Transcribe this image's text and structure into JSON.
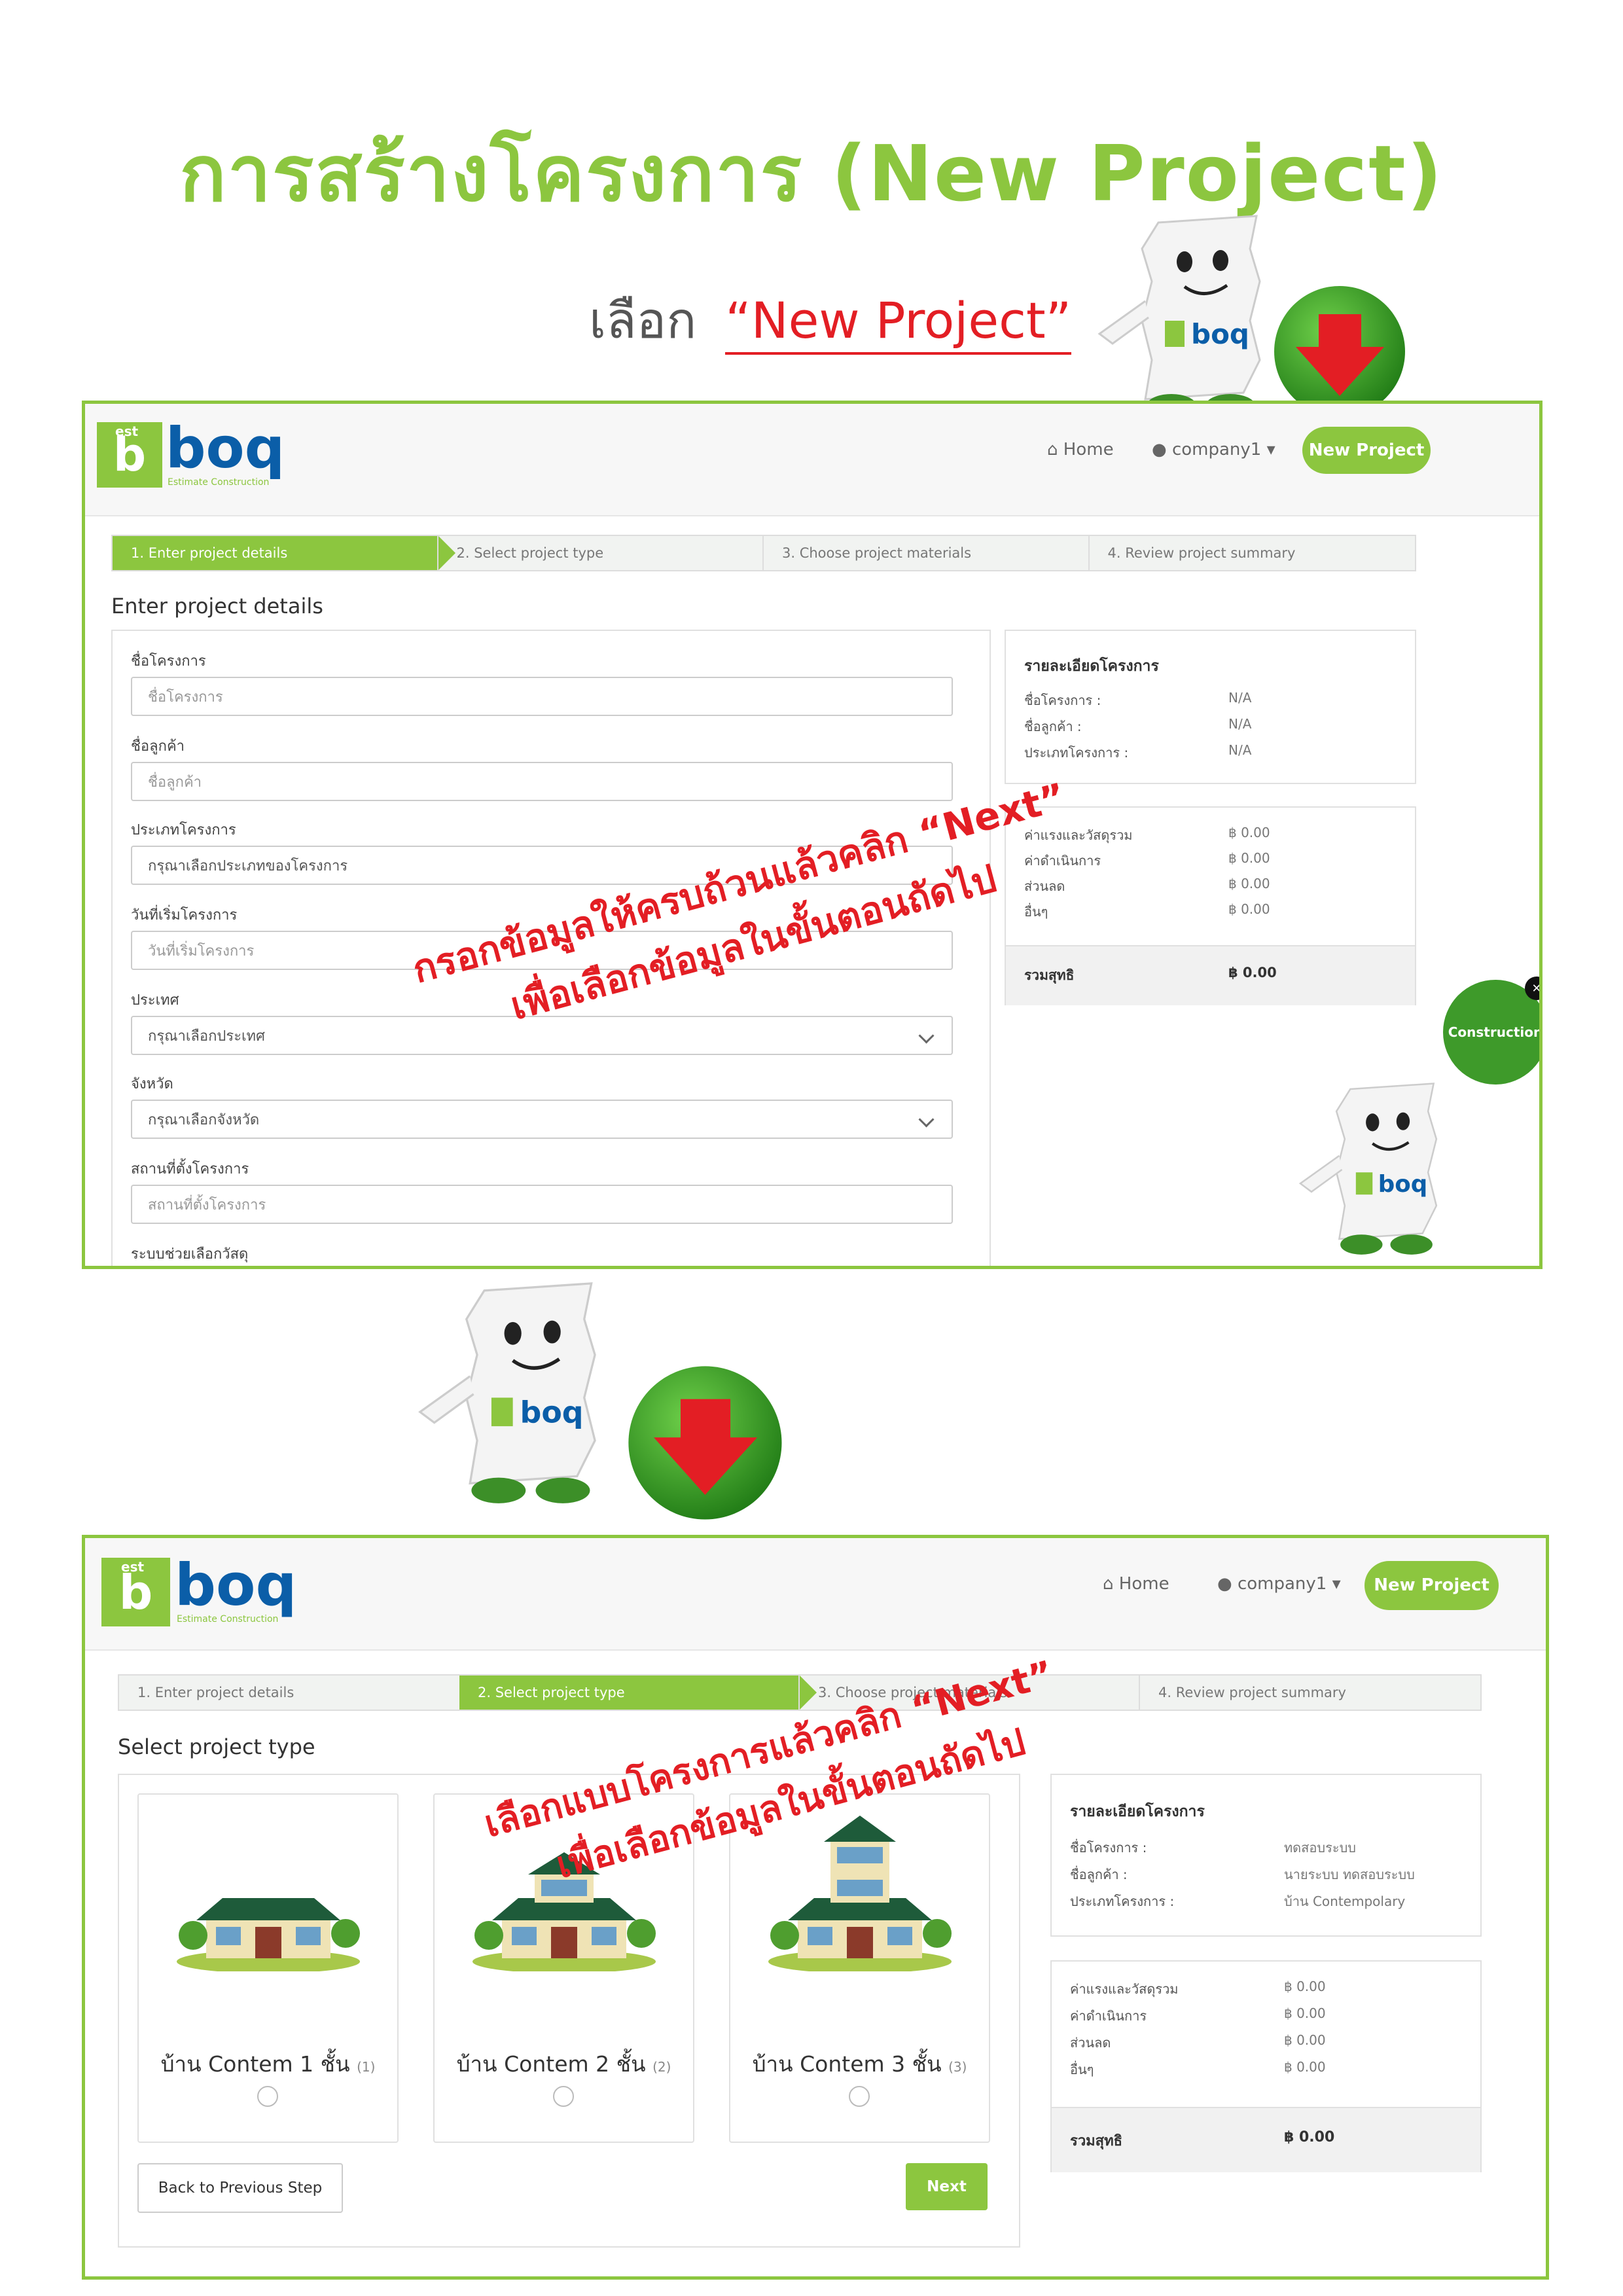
{
  "page": {
    "title": "การสร้างโครงการ (New Project)",
    "instruction_prefix": "เลือก",
    "instruction_quote": "“New Project”"
  },
  "app": {
    "logo_box_text": "b",
    "logo_box_small": "est",
    "logo_text": "boq",
    "logo_sub": "Estimate Construction",
    "nav_home": "Home",
    "nav_user": "company1",
    "nav_new_project": "New Project",
    "steps": [
      "1. Enter project details",
      "2. Select project type",
      "3. Choose project materials",
      "4. Review project summary"
    ]
  },
  "screen1": {
    "heading": "Enter project details",
    "fields": [
      {
        "label": "ชื่อโครงการ",
        "placeholder": "ชื่อโครงการ"
      },
      {
        "label": "ชื่อลูกค้า",
        "placeholder": "ชื่อลูกค้า"
      },
      {
        "label": "ประเภทโครงการ",
        "placeholder": "กรุณาเลือกประเภทของโครงการ"
      },
      {
        "label": "วันที่เริ่มโครงการ",
        "placeholder": "วันที่เริ่มโครงการ"
      },
      {
        "label": "ประเทศ",
        "placeholder": "กรุณาเลือกประเทศ"
      },
      {
        "label": "จังหวัด",
        "placeholder": "กรุณาเลือกจังหวัด"
      },
      {
        "label": "สถานที่ตั้งโครงการ",
        "placeholder": "สถานที่ตั้งโครงการ"
      },
      {
        "label": "ระบบช่วยเลือกวัสดุ",
        "placeholder": ""
      }
    ],
    "summary": {
      "title": "รายละเอียดโครงการ",
      "rows": [
        {
          "k": "ชื่อโครงการ :",
          "v": "N/A"
        },
        {
          "k": "ชื่อลูกค้า :",
          "v": "N/A"
        },
        {
          "k": "ประเภทโครงการ :",
          "v": "N/A"
        }
      ]
    },
    "costs": {
      "rows": [
        {
          "k": "ค่าแรงและวัสดุรวม",
          "v": "฿ 0.00"
        },
        {
          "k": "ค่าดำเนินการ",
          "v": "฿ 0.00"
        },
        {
          "k": "ส่วนลด",
          "v": "฿ 0.00"
        },
        {
          "k": "อื่นๆ",
          "v": "฿ 0.00"
        }
      ],
      "total_label": "รวมสุทธิ",
      "total_value": "฿ 0.00"
    },
    "overlay_line1": "กรอกข้อมูลให้ครบถ้วนแล้วคลิก “Next”",
    "overlay_line2": "เพื่อเลือกข้อมูลในขั้นตอนถัดไป",
    "badge_text": "Construction",
    "badge_close": "✕"
  },
  "screen2": {
    "heading": "Select project type",
    "houses": [
      {
        "label": "บ้าน Contem 1 ชั้น",
        "num": "(1)"
      },
      {
        "label": "บ้าน Contem 2 ชั้น",
        "num": "(2)"
      },
      {
        "label": "บ้าน Contem 3 ชั้น",
        "num": "(3)"
      }
    ],
    "back_button": "Back to Previous Step",
    "next_button": "Next",
    "summary": {
      "title": "รายละเอียดโครงการ",
      "rows": [
        {
          "k": "ชื่อโครงการ :",
          "v": "ทดสอบระบบ"
        },
        {
          "k": "ชื่อลูกค้า :",
          "v": "นายระบบ ทดสอบระบบ"
        },
        {
          "k": "ประเภทโครงการ :",
          "v": "บ้าน Contempolary"
        }
      ]
    },
    "costs": {
      "rows": [
        {
          "k": "ค่าแรงและวัสดุรวม",
          "v": "฿ 0.00"
        },
        {
          "k": "ค่าดำเนินการ",
          "v": "฿ 0.00"
        },
        {
          "k": "ส่วนลด",
          "v": "฿ 0.00"
        },
        {
          "k": "อื่นๆ",
          "v": "฿ 0.00"
        }
      ],
      "total_label": "รวมสุทธิ",
      "total_value": "฿ 0.00"
    },
    "overlay_line1": "เลือกแบบโครงการแล้วคลิก “Next”",
    "overlay_line2": "เพื่อเลือกข้อมูลในขั้นตอนถัดไป"
  },
  "colors": {
    "brand_green": "#8cc63f",
    "brand_blue": "#0b5ea8",
    "overlay_red": "#e31e24",
    "arrow_circle": "#2e8b1f"
  }
}
